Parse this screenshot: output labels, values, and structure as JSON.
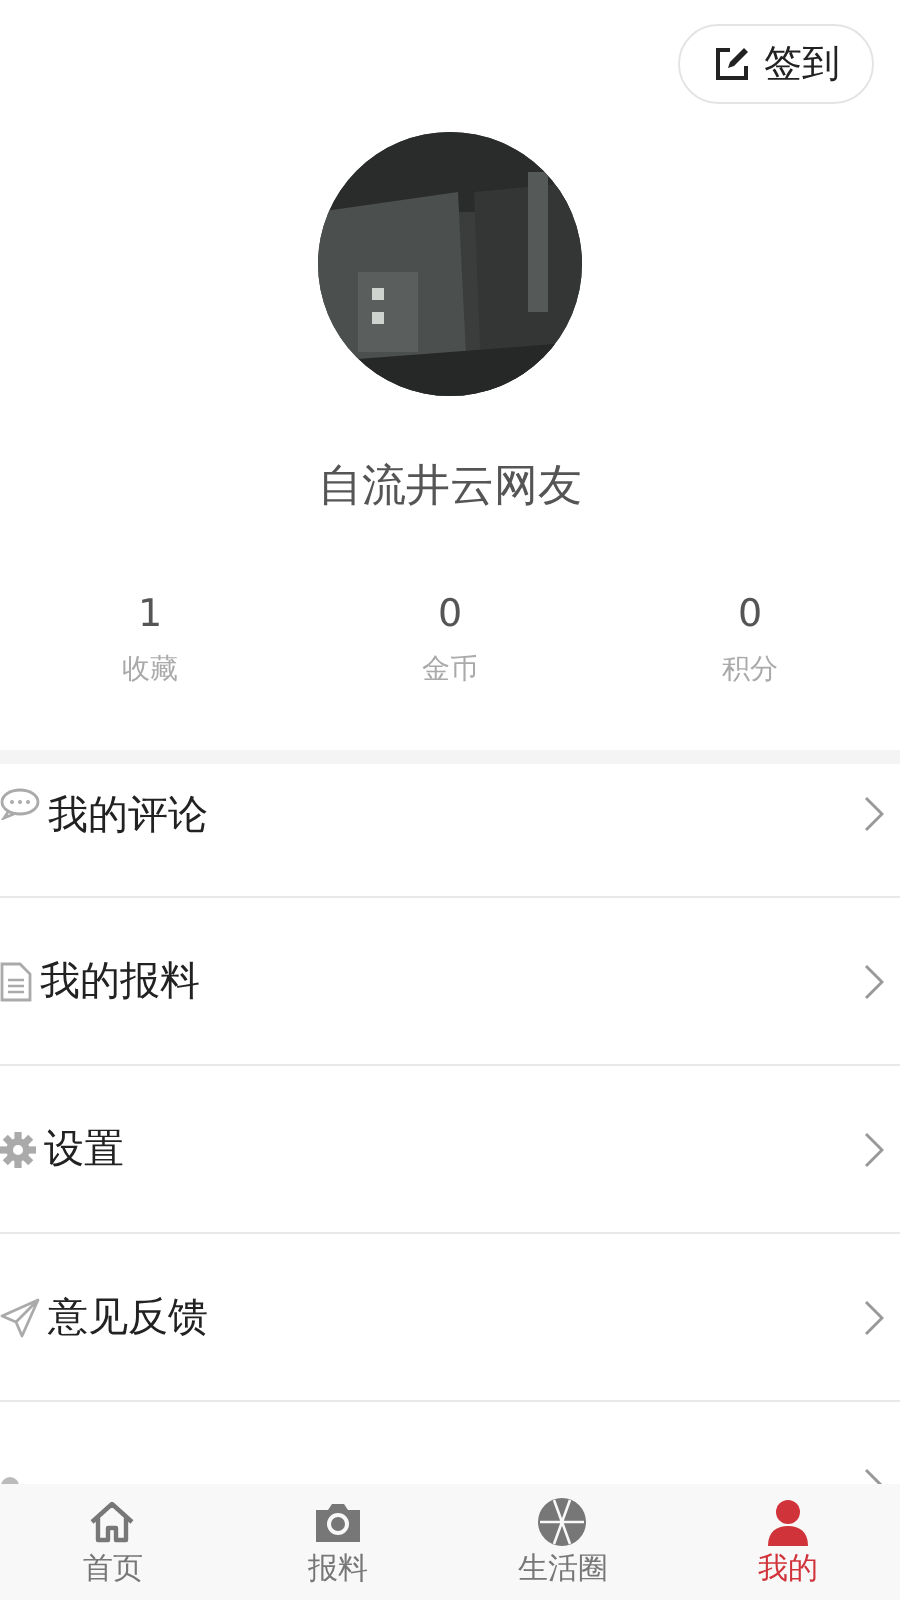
{
  "sign_in_button": {
    "label": "签到"
  },
  "profile": {
    "name": "自流井云网友"
  },
  "stats": [
    {
      "value": "1",
      "label": "收藏"
    },
    {
      "value": "0",
      "label": "金币"
    },
    {
      "value": "0",
      "label": "积分"
    }
  ],
  "menu": [
    {
      "kind": "comment",
      "label": "我的评论"
    },
    {
      "kind": "document",
      "label": "我的报料"
    },
    {
      "kind": "gear",
      "label": "设置"
    },
    {
      "kind": "send",
      "label": "意见反馈"
    },
    {
      "kind": "dot"
    }
  ],
  "tab_bar": [
    {
      "kind": "home",
      "label": "首页",
      "selected": false
    },
    {
      "kind": "camera",
      "label": "报料",
      "selected": false
    },
    {
      "kind": "aperture",
      "label": "生活圈",
      "selected": false
    },
    {
      "kind": "person",
      "label": "我的",
      "selected": true
    }
  ]
}
